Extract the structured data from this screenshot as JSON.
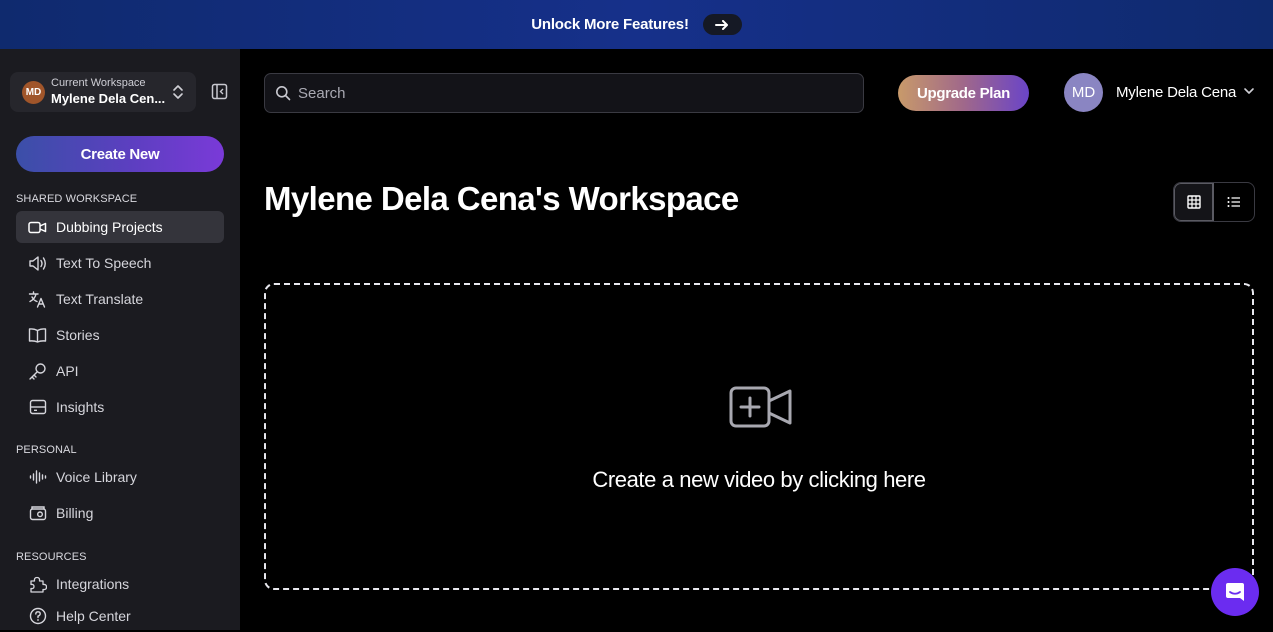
{
  "banner": {
    "text": "Unlock More Features!",
    "arrow_icon": "arrow-right-icon"
  },
  "sidebar": {
    "workspace": {
      "initials": "MD",
      "label": "Current Workspace",
      "name": "Mylene Dela Cen..."
    },
    "create_new_label": "Create New",
    "sections": {
      "shared": "SHARED WORKSPACE",
      "personal": "PERSONAL",
      "resources": "RESOURCES"
    },
    "shared_items": [
      {
        "label": "Dubbing Projects",
        "icon": "video-camera-icon",
        "active": true
      },
      {
        "label": "Text To Speech",
        "icon": "speaker-icon"
      },
      {
        "label": "Text Translate",
        "icon": "translate-icon"
      },
      {
        "label": "Stories",
        "icon": "book-icon"
      },
      {
        "label": "API",
        "icon": "key-icon"
      },
      {
        "label": "Insights",
        "icon": "insights-icon"
      }
    ],
    "personal_items": [
      {
        "label": "Voice Library",
        "icon": "waveform-icon"
      },
      {
        "label": "Billing",
        "icon": "billing-icon"
      }
    ],
    "resource_items": [
      {
        "label": "Integrations",
        "icon": "puzzle-icon"
      },
      {
        "label": "Help Center",
        "icon": "help-icon"
      }
    ]
  },
  "header": {
    "search_placeholder": "Search",
    "upgrade_label": "Upgrade Plan",
    "user": {
      "initials": "MD",
      "name": "Mylene Dela Cena"
    }
  },
  "main": {
    "title": "Mylene Dela Cena's Workspace",
    "dropzone_text": "Create a new video by clicking here"
  },
  "colors": {
    "banner": "#16308a",
    "sidebar_bg": "#1b1b20",
    "accent_purple": "#6b2cf0",
    "background": "#000000"
  }
}
